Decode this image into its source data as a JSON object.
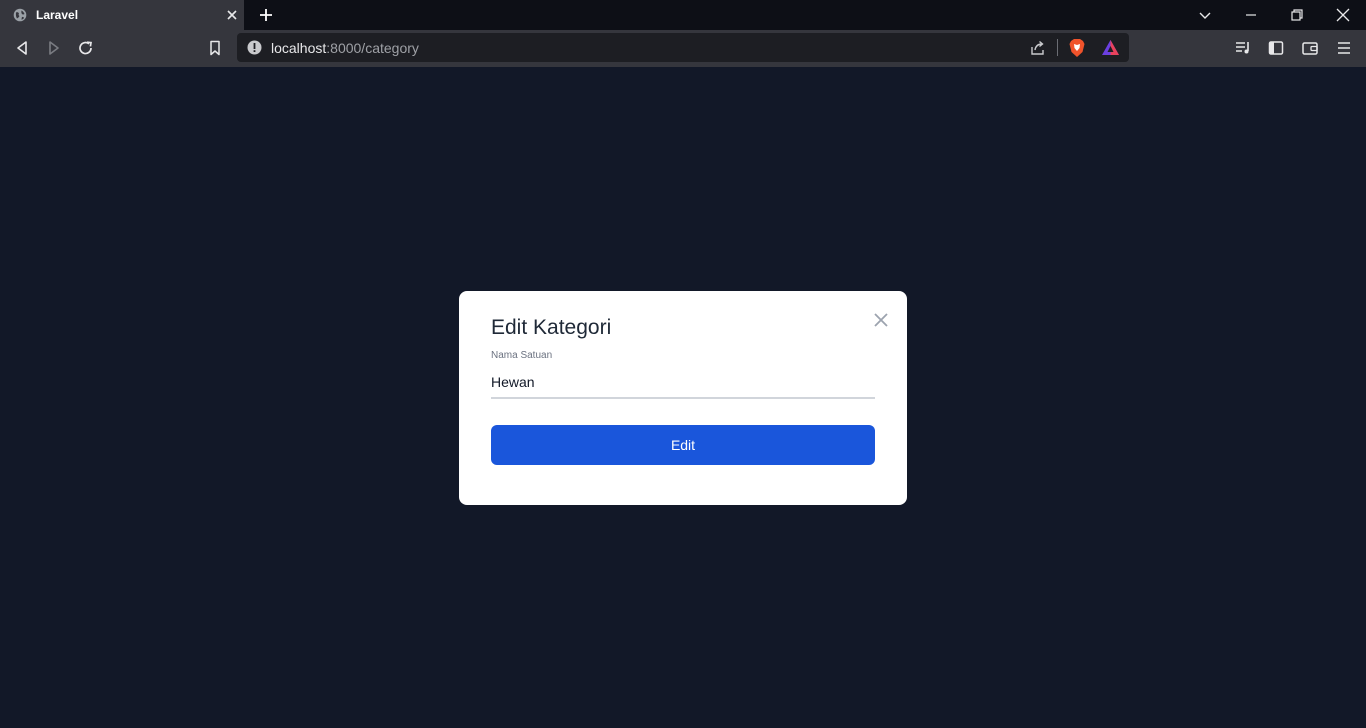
{
  "browser": {
    "tab": {
      "title": "Laravel"
    },
    "address_bar": {
      "host": "localhost",
      "path": ":8000/category"
    }
  },
  "modal": {
    "title": "Edit Kategori",
    "field": {
      "label": "Nama Satuan",
      "value": "Hewan"
    },
    "submit_label": "Edit"
  },
  "colors": {
    "page_background": "#121828",
    "primary_button": "#1a56db",
    "modal_background": "#ffffff"
  },
  "icons": {
    "tab": "globe-icon",
    "brave": "brave-shield-icon",
    "rewards": "brave-rewards-icon"
  }
}
